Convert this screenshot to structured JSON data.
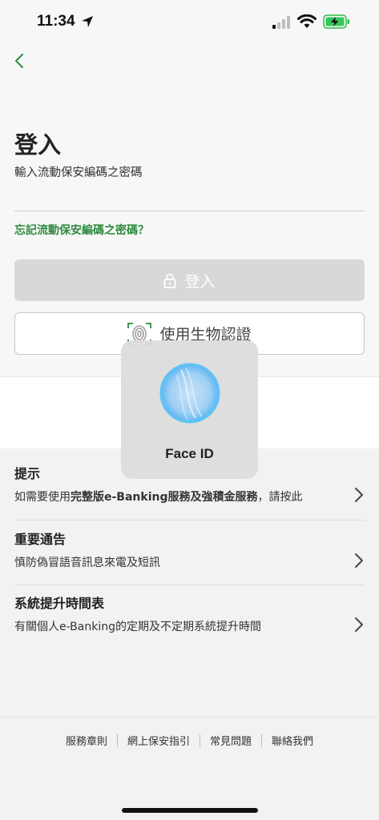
{
  "status_bar": {
    "time": "11:34"
  },
  "login": {
    "title": "登入",
    "subtitle": "輸入流動保安編碼之密碼",
    "password_value": "",
    "forgot_link": "忘記流動保安編碼之密碼？",
    "login_button": "登入",
    "biometric_button": "使用生物認證"
  },
  "face_id": {
    "label": "Face ID"
  },
  "info": {
    "items": [
      {
        "title": "提示",
        "desc_pre": "如需要使用",
        "desc_bold1": "完整版e-Banking服務",
        "desc_mid": "及",
        "desc_bold2": "強積金服務",
        "desc_post": "，請按此"
      },
      {
        "title": "重要通告",
        "desc": "慎防偽冒語音訊息來電及短訊"
      },
      {
        "title": "系統提升時間表",
        "desc": "有關個人e-Banking的定期及不定期系統提升時間"
      }
    ]
  },
  "footer": {
    "links": [
      "服務章則",
      "網上保安指引",
      "常見問題",
      "聯絡我們"
    ]
  },
  "colors": {
    "accent": "#2e8b3e",
    "disabled_button": "#d8d8d8"
  }
}
